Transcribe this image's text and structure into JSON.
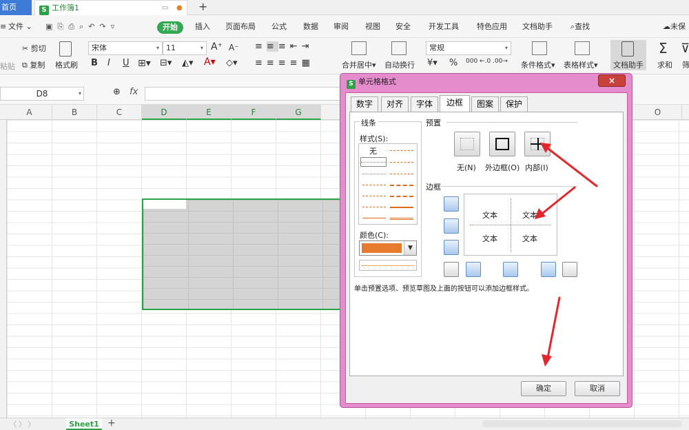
{
  "tabs": {
    "home": "首页",
    "workbook": "工作簿1",
    "new_tab": "+"
  },
  "menu": {
    "file": "文件",
    "start": "开始",
    "items": [
      "插入",
      "页面布局",
      "公式",
      "数据",
      "审阅",
      "视图",
      "安全",
      "开发工具",
      "特色应用",
      "文档助手"
    ],
    "search": "查找",
    "cloud": "未保"
  },
  "ribbon": {
    "paste": "粘贴",
    "cut": "剪切",
    "copy": "复制",
    "format_painter": "格式刷",
    "font_name": "宋体",
    "font_size": "11",
    "grow": "A⁺",
    "shrink": "A⁻",
    "bold": "B",
    "italic": "I",
    "underline": "U",
    "merge": "合并居中",
    "wrap": "自动换行",
    "number_format": "常规",
    "currency": "¥",
    "percent": "%",
    "conditional": "条件格式",
    "table_style": "表格样式",
    "doc_helper": "文档助手",
    "sum": "求和",
    "filter": "筛"
  },
  "formula_bar": {
    "name_box": "D8",
    "fx": "fx"
  },
  "columns": [
    "A",
    "B",
    "C",
    "D",
    "E",
    "F",
    "G",
    "O"
  ],
  "sheet_tab": "Sheet1",
  "dialog": {
    "title": "单元格格式",
    "close": "×",
    "tabs": [
      "数字",
      "对齐",
      "字体",
      "边框",
      "图案",
      "保护"
    ],
    "line_group": "线条",
    "style_label": "样式(S):",
    "style_none": "无",
    "color_label": "颜色(C):",
    "color_value": "#e87a2d",
    "preset_group": "预置",
    "presets": [
      "无(N)",
      "外边框(O)",
      "内部(I)"
    ],
    "border_group": "边框",
    "preview_text": [
      "文本",
      "文本",
      "文本",
      "文本"
    ],
    "hint": "单击预置选项、预览草图及上面的按钮可以添加边框样式。",
    "ok": "确定",
    "cancel": "取消"
  },
  "accent_color": "#2ba245",
  "annotation_color": "#e3262b"
}
